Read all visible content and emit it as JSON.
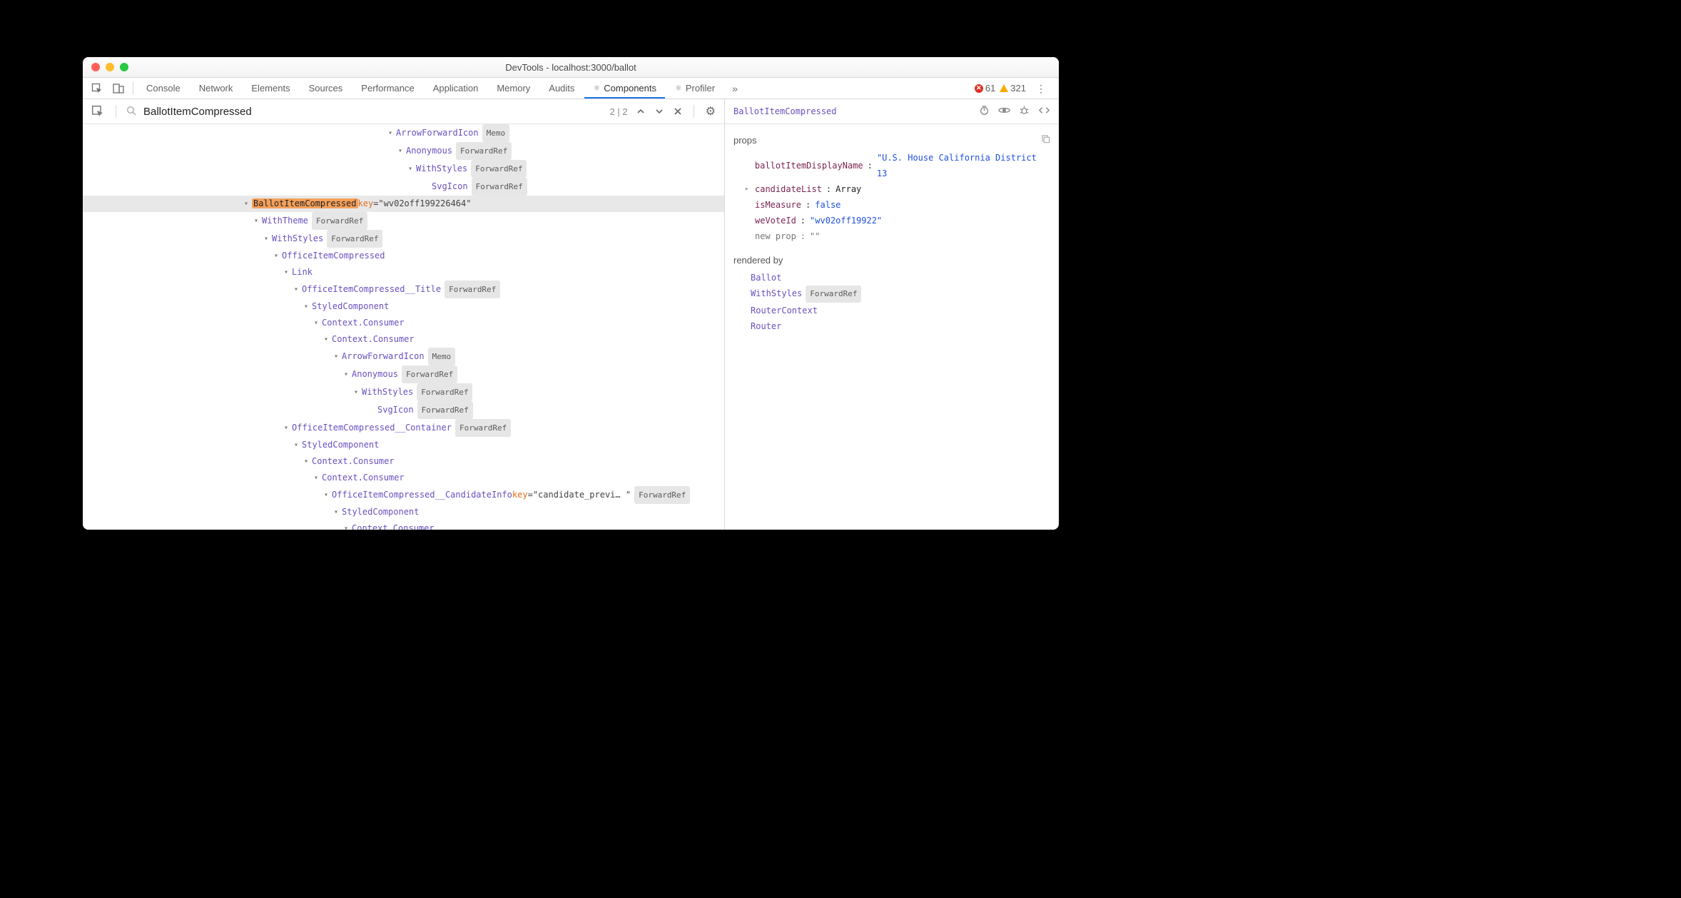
{
  "window": {
    "title": "DevTools - localhost:3000/ballot"
  },
  "tabs": {
    "items": [
      "Console",
      "Network",
      "Elements",
      "Sources",
      "Performance",
      "Application",
      "Memory",
      "Audits",
      "Components",
      "Profiler"
    ],
    "active": "Components",
    "errors": "61",
    "warnings": "321"
  },
  "search": {
    "value": "BallotItemCompressed",
    "matchCount": "2 | 2"
  },
  "tree": [
    {
      "indent": 426,
      "arrow": "▾",
      "comp": "ArrowForwardIcon",
      "badge": "Memo"
    },
    {
      "indent": 440,
      "arrow": "▾",
      "comp": "Anonymous",
      "badge": "ForwardRef"
    },
    {
      "indent": 454,
      "arrow": "▾",
      "comp": "WithStyles",
      "badge": "ForwardRef"
    },
    {
      "indent": 476,
      "arrow": "",
      "comp": "SvgIcon",
      "badge": "ForwardRef"
    },
    {
      "indent": 224,
      "arrow": "▾",
      "compHl": "BallotItemCompressed",
      "attrKey": "key",
      "attrVal": "\"wv02off199226464\"",
      "selected": true
    },
    {
      "indent": 238,
      "arrow": "▾",
      "comp": "WithTheme",
      "badge": "ForwardRef"
    },
    {
      "indent": 252,
      "arrow": "▾",
      "comp": "WithStyles",
      "badge": "ForwardRef"
    },
    {
      "indent": 266,
      "arrow": "▾",
      "comp": "OfficeItemCompressed"
    },
    {
      "indent": 280,
      "arrow": "▾",
      "comp": "Link"
    },
    {
      "indent": 294,
      "arrow": "▾",
      "comp": "OfficeItemCompressed__Title",
      "badge": "ForwardRef"
    },
    {
      "indent": 308,
      "arrow": "▾",
      "comp": "StyledComponent"
    },
    {
      "indent": 322,
      "arrow": "▾",
      "comp": "Context.Consumer"
    },
    {
      "indent": 336,
      "arrow": "▾",
      "comp": "Context.Consumer"
    },
    {
      "indent": 350,
      "arrow": "▾",
      "comp": "ArrowForwardIcon",
      "badge": "Memo"
    },
    {
      "indent": 364,
      "arrow": "▾",
      "comp": "Anonymous",
      "badge": "ForwardRef"
    },
    {
      "indent": 378,
      "arrow": "▾",
      "comp": "WithStyles",
      "badge": "ForwardRef"
    },
    {
      "indent": 400,
      "arrow": "",
      "comp": "SvgIcon",
      "badge": "ForwardRef"
    },
    {
      "indent": 280,
      "arrow": "▾",
      "comp": "OfficeItemCompressed__Container",
      "badge": "ForwardRef"
    },
    {
      "indent": 294,
      "arrow": "▾",
      "comp": "StyledComponent"
    },
    {
      "indent": 308,
      "arrow": "▾",
      "comp": "Context.Consumer"
    },
    {
      "indent": 322,
      "arrow": "▾",
      "comp": "Context.Consumer"
    },
    {
      "indent": 336,
      "arrow": "▾",
      "comp": "OfficeItemCompressed__CandidateInfo",
      "attrKey": "key",
      "attrVal": "\"candidate_previ… \"",
      "badge": "ForwardRef"
    },
    {
      "indent": 350,
      "arrow": "▾",
      "comp": "StyledComponent"
    },
    {
      "indent": 364,
      "arrow": "▾",
      "comp": "Context.Consumer"
    }
  ],
  "inspector": {
    "title": "BallotItemCompressed",
    "propsLabel": "props",
    "props": [
      {
        "key": "ballotItemDisplayName",
        "kind": "str",
        "val": "\"U.S. House California District 13"
      },
      {
        "key": "candidateList",
        "kind": "arr",
        "val": "Array",
        "arrow": "▸"
      },
      {
        "key": "isMeasure",
        "kind": "lit",
        "val": "false"
      },
      {
        "key": "weVoteId",
        "kind": "str",
        "val": "\"wv02off19922\""
      }
    ],
    "newPropKey": "new prop",
    "newPropVal": "\"\"",
    "renderedByLabel": "rendered by",
    "renderedBy": [
      {
        "name": "Ballot"
      },
      {
        "name": "WithStyles",
        "badge": "ForwardRef"
      },
      {
        "name": "RouterContext"
      },
      {
        "name": "Router"
      }
    ]
  }
}
